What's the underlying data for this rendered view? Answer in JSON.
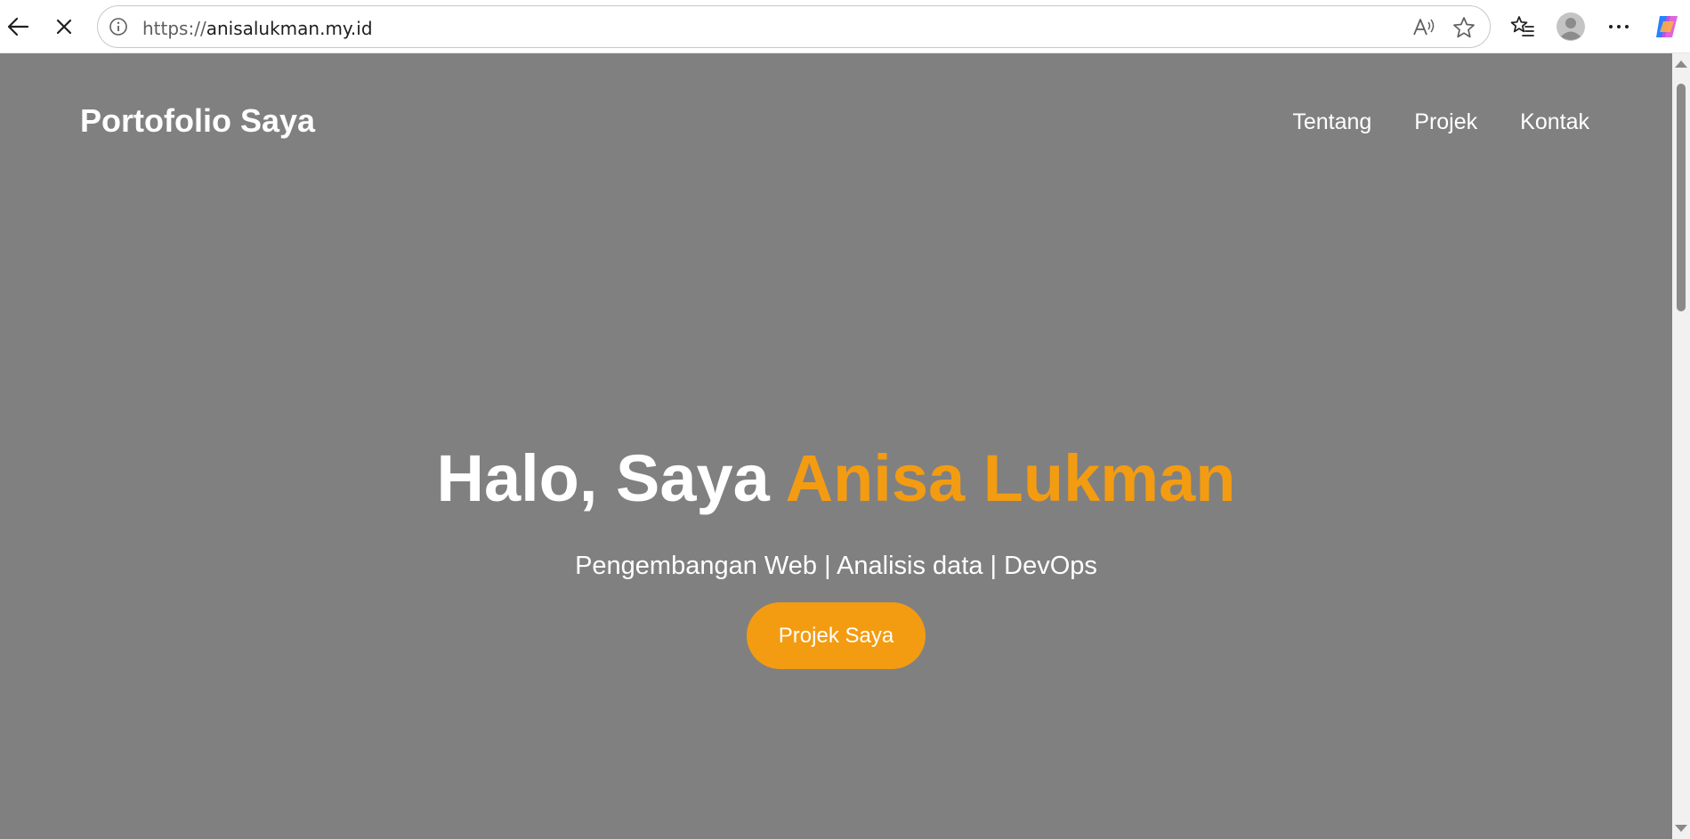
{
  "browser": {
    "url_protocol": "https://",
    "url_host": "anisalukman.my.id",
    "icons": [
      "back-arrow-icon",
      "stop-loading-icon",
      "site-info-icon",
      "read-aloud-icon",
      "favorite-star-icon",
      "favorites-list-icon",
      "profile-avatar-icon",
      "more-options-icon",
      "copilot-icon"
    ]
  },
  "site": {
    "brand": "Portofolio Saya",
    "nav": [
      "Tentang",
      "Projek",
      "Kontak"
    ]
  },
  "hero": {
    "title_prefix": "Halo, Saya ",
    "title_name": "Anisa Lukman",
    "subtitle": "Pengembangan Web | Analisis data | DevOps",
    "button_label": "Projek Saya"
  },
  "colors": {
    "page_background": "#808080",
    "accent": "#f39c12",
    "text": "#ffffff"
  }
}
